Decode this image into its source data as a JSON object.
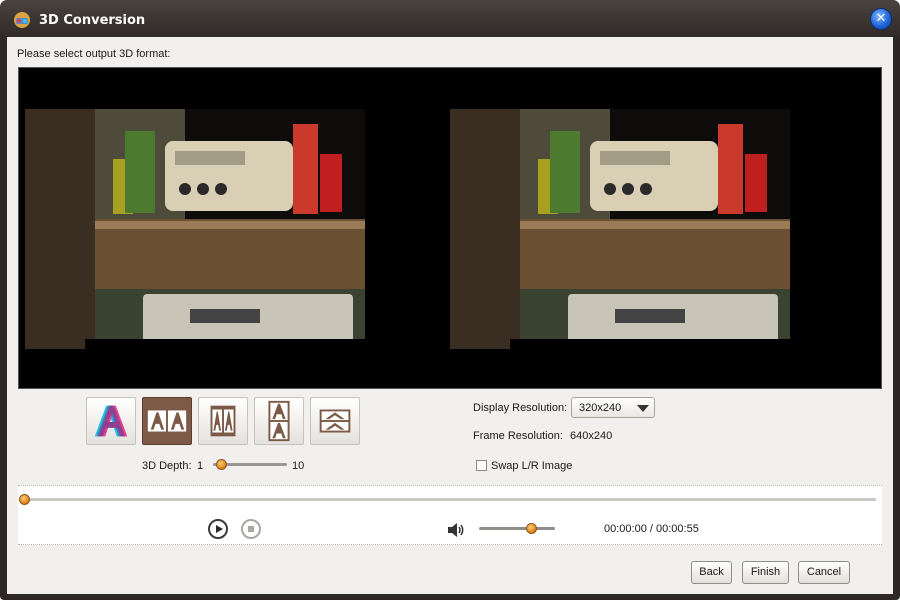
{
  "window": {
    "title": "3D Conversion",
    "close_icon": "close-icon"
  },
  "prompt": "Please select output 3D format:",
  "formats": {
    "items": [
      {
        "name": "anaglyph",
        "icon": "anaglyph-icon"
      },
      {
        "name": "side-by-side-full",
        "icon": "side-by-side-icon"
      },
      {
        "name": "side-by-side-half",
        "icon": "side-by-side-half-icon"
      },
      {
        "name": "top-and-bottom-full",
        "icon": "top-bottom-icon"
      },
      {
        "name": "top-and-bottom-half",
        "icon": "top-bottom-half-icon"
      }
    ],
    "selected_index": 1
  },
  "depth": {
    "label": "3D Depth:",
    "min": "1",
    "max": "10",
    "value": 2
  },
  "display_resolution": {
    "label": "Display Resolution:",
    "value": "320x240"
  },
  "frame_resolution": {
    "label": "Frame Resolution:",
    "value": "640x240"
  },
  "swap": {
    "label": "Swap L/R Image",
    "checked": false
  },
  "playback": {
    "time": "00:00:00 / 00:00:55",
    "position": 0,
    "volume_fraction": 0.68
  },
  "buttons": {
    "back": "Back",
    "finish": "Finish",
    "cancel": "Cancel"
  },
  "colors": {
    "accent_knob": "#e07b14",
    "selected_format": "#7c5a47",
    "title_bar": "#2d2826"
  }
}
